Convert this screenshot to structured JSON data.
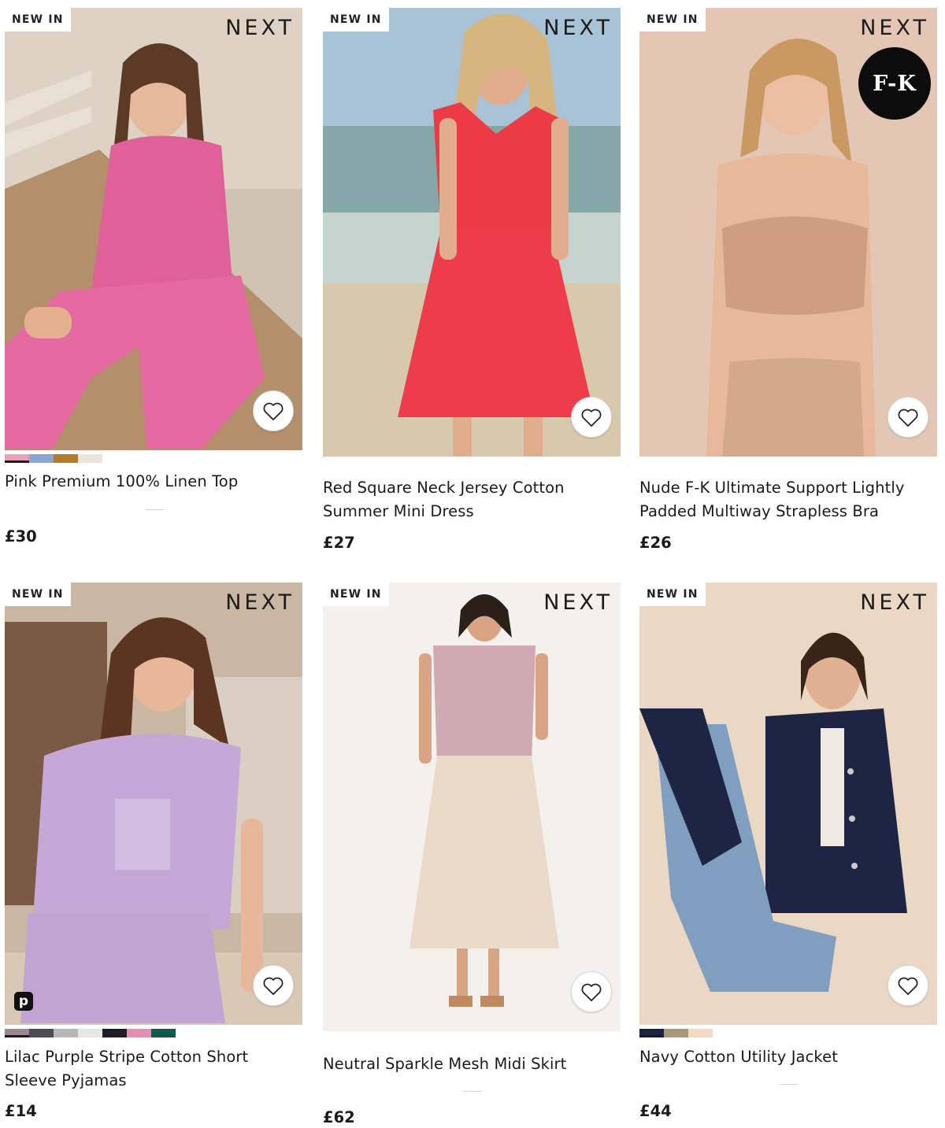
{
  "products": [
    {
      "badge": "NEW IN",
      "brand": "NEXT",
      "title": "Pink Premium 100% Linen Top",
      "price": "£30",
      "colour_swatches": [
        "#e8a2b8",
        "#8aa4d6",
        "#b47a2c",
        "#ebe6d8"
      ],
      "favourite_icon": "heart-outline-icon"
    },
    {
      "badge": "NEW IN",
      "brand": "NEXT",
      "title": "Red Square Neck Jersey Cotton Summer Mini Dress",
      "price": "£27",
      "colour_swatches": [],
      "favourite_icon": "heart-outline-icon"
    },
    {
      "badge": "NEW IN",
      "brand": "NEXT",
      "sub_brand": "F-K",
      "title": "Nude F-K Ultimate Support Lightly Padded Multiway Strapless Bra",
      "price": "£26",
      "colour_swatches": [],
      "favourite_icon": "heart-outline-icon"
    },
    {
      "badge": "NEW IN",
      "brand": "NEXT",
      "title": "Lilac Purple Stripe Cotton Short Sleeve Pyjamas",
      "price": "£14",
      "colour_swatches": [
        "#9b8a92",
        "#4b4d55",
        "#b7b7b7",
        "#e6e6e6",
        "#1e1e24",
        "#e58db0",
        "#0f5a4a"
      ],
      "partner_icon": "p",
      "favourite_icon": "heart-outline-icon"
    },
    {
      "badge": "NEW IN",
      "brand": "NEXT",
      "title": "Neutral Sparkle Mesh Midi Skirt",
      "price": "£62",
      "colour_swatches": [],
      "favourite_icon": "heart-outline-icon"
    },
    {
      "badge": "NEW IN",
      "brand": "NEXT",
      "title": "Navy Cotton Utility Jacket",
      "price": "£44",
      "colour_swatches": [
        "#1d2340",
        "#a89878",
        "#f3d9c3"
      ],
      "favourite_icon": "heart-outline-icon"
    }
  ]
}
